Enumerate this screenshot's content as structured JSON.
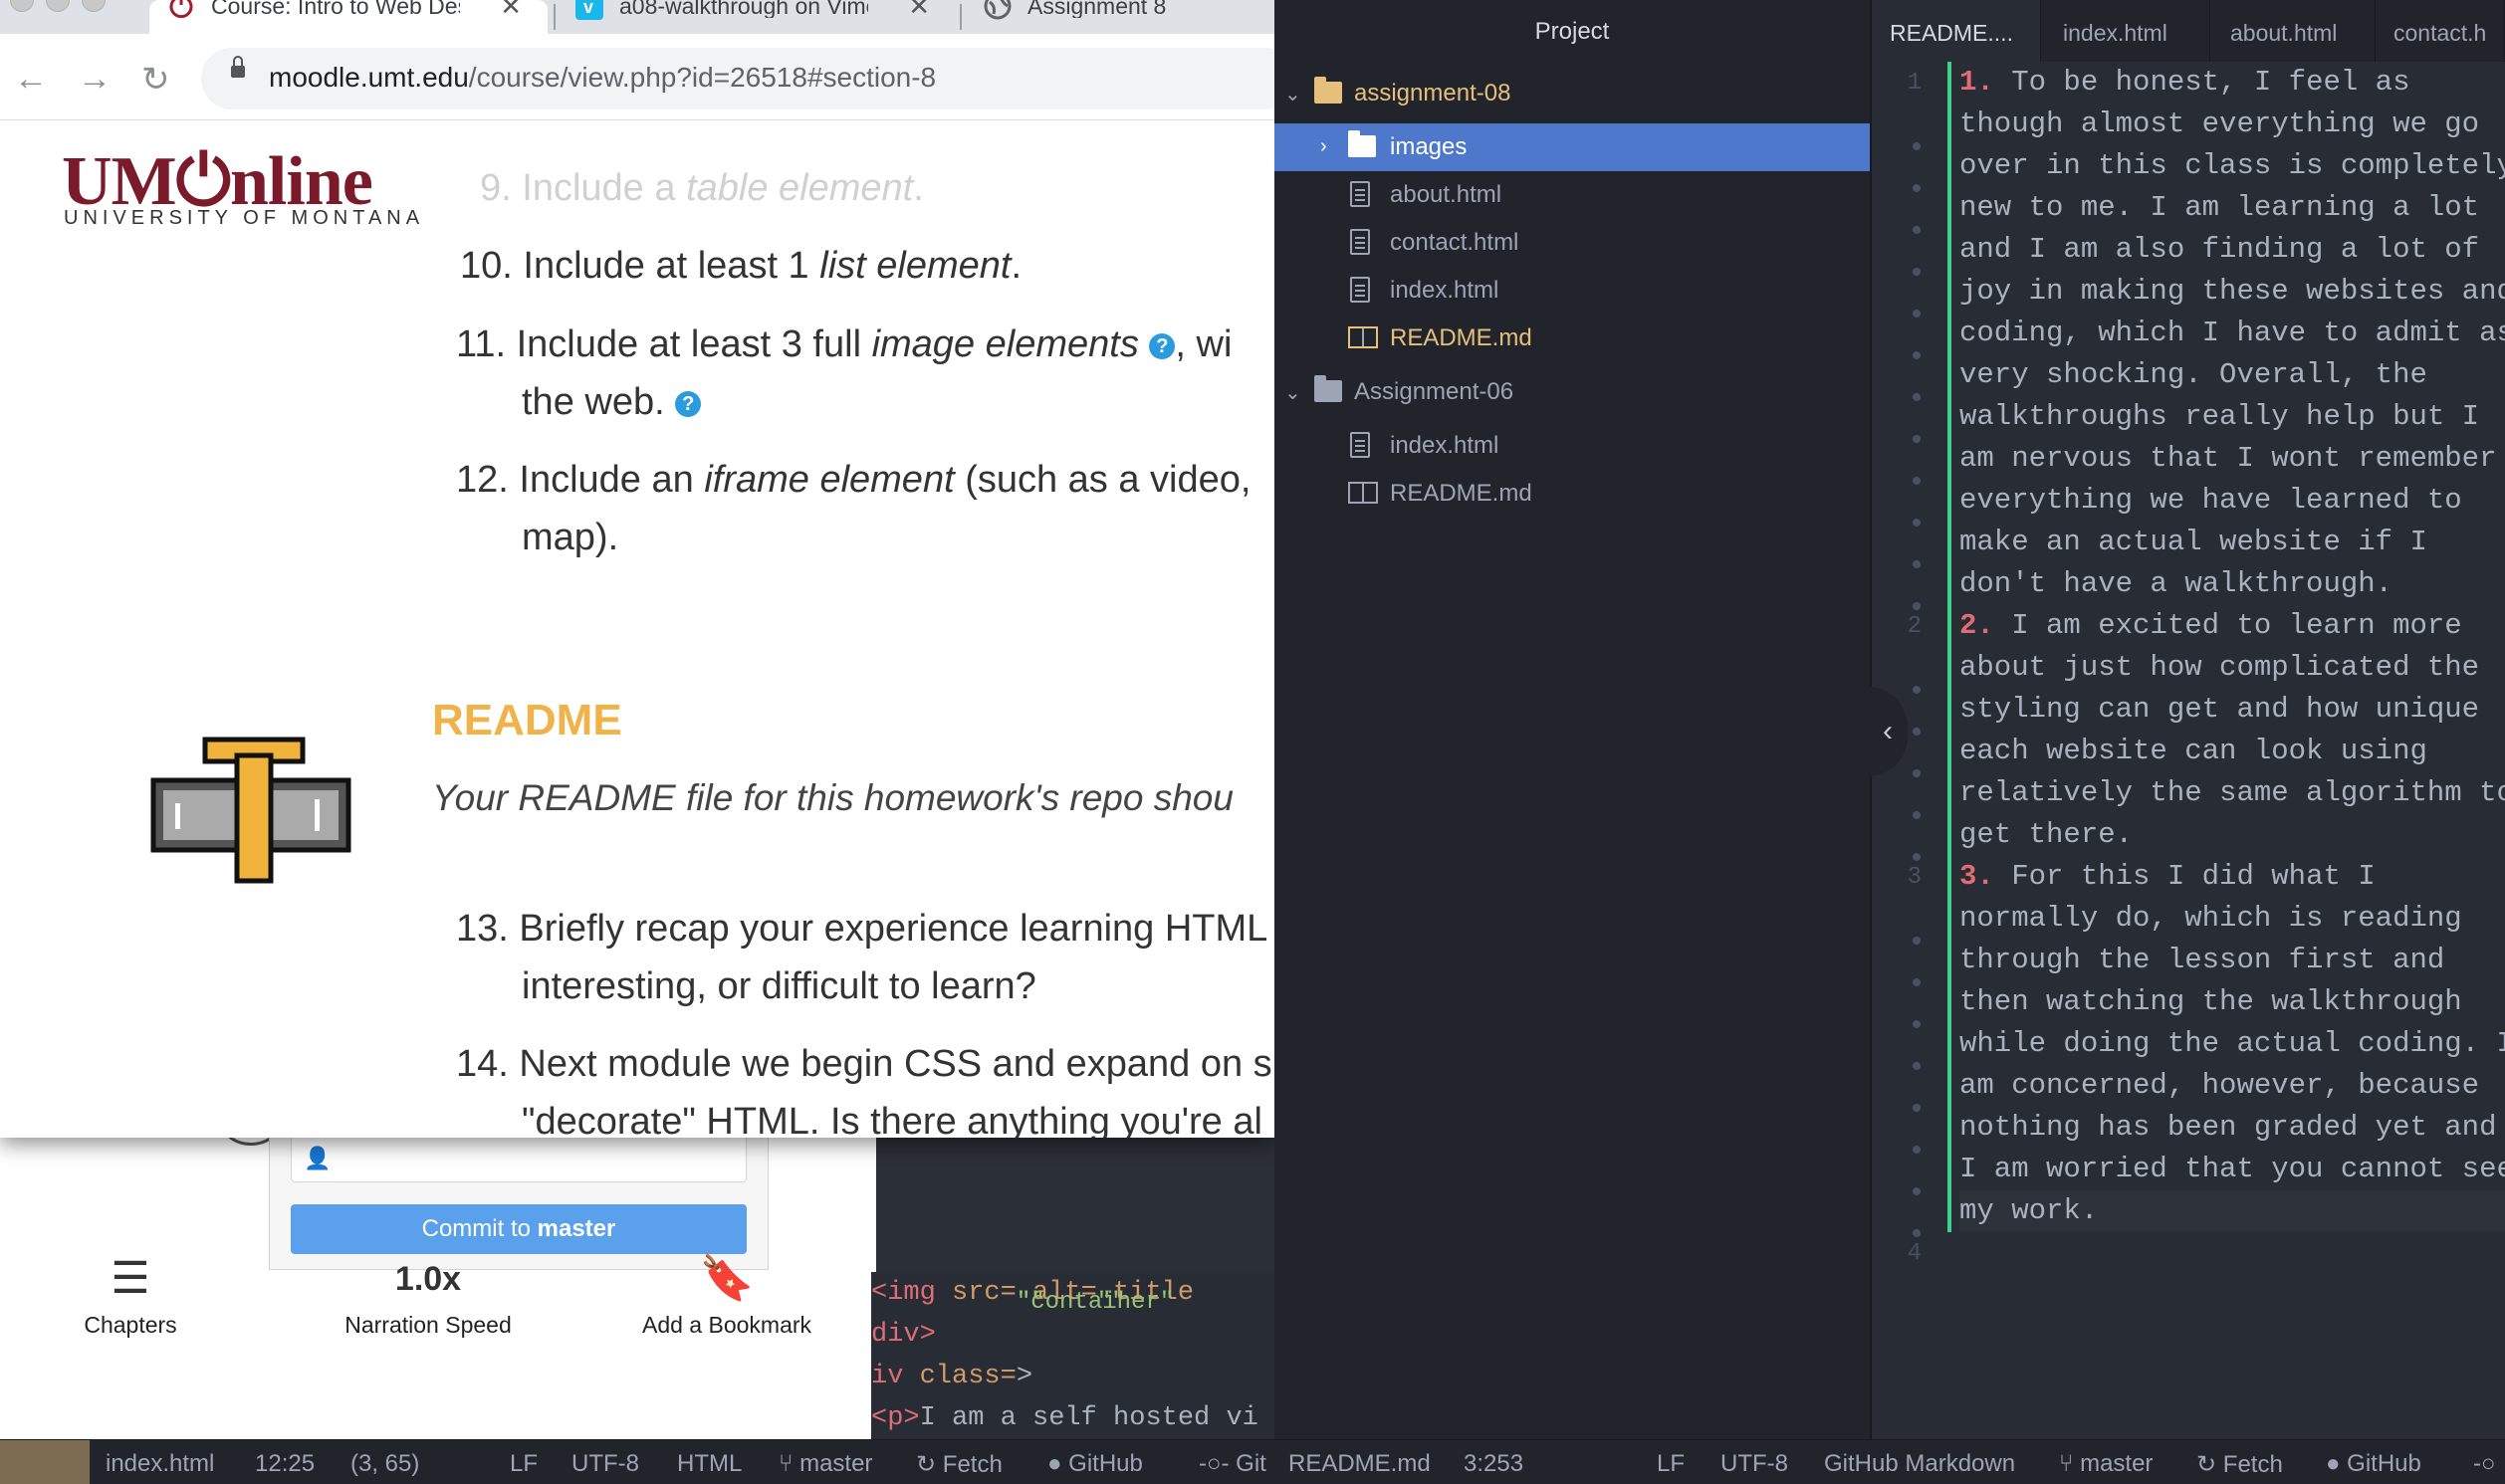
{
  "browser": {
    "tabs": [
      {
        "title": "Course: Intro to Web Desi",
        "favicon": "power-icon"
      },
      {
        "title": "a08-walkthrough on Vimeo",
        "favicon": "vimeo-icon"
      },
      {
        "title": "Assignment 8",
        "favicon": "globe-icon"
      }
    ],
    "close_glyph": "✕",
    "url_host": "moodle.umt.edu",
    "url_path": "/course/view.php?id=26518#section-8"
  },
  "page": {
    "logo_main": "UM⏻nline",
    "logo_sub": "UNIVERSITY OF MONTANA",
    "items": {
      "i9_num": "9.",
      "i9_pre": "Include a ",
      "i9_em": "table element",
      "i9_post": ".",
      "i10_num": "10.",
      "i10_pre": "Include at least 1 ",
      "i10_em": "list element",
      "i10_post": ".",
      "i11_num": "11.",
      "i11_pre": "Include at least 3 full ",
      "i11_em": "image elements",
      "i11_tail": ", wi",
      "i11_line2": "the web.",
      "i12_num": "12.",
      "i12_pre": "Include an ",
      "i12_em": "iframe element",
      "i12_post": " (such as a video,",
      "i12_line2": "map).",
      "i13_num": "13.",
      "i13_text": "Briefly recap your experience learning HTML",
      "i13_line2": "interesting, or difficult to learn?",
      "i14_num": "14.",
      "i14_text": "Next module we begin CSS and expand on s",
      "i14_line2": "\"decorate\" HTML. Is there anything you're al"
    },
    "readme_heading": "README",
    "readme_desc": "Your README file for this homework's repo shou",
    "help_glyph": "?"
  },
  "video": {
    "chapters": "Chapters",
    "speed_value": "1.0x",
    "speed_label": "Narration Speed",
    "bookmark": "Add a Bookmark"
  },
  "commit": {
    "button_pre": "Commit to ",
    "button_branch": "master"
  },
  "code_snippet": {
    "l1_tag": "<img",
    "l1_a1": " src=",
    "l1_v1": "\"\"",
    "l1_a2": " alt=",
    "l1_v2": "\"\"",
    "l1_a3": " title",
    "l2": "div>",
    "l3_tag": "iv",
    "l3_attr": " class=",
    "l3_val": "\"container\"",
    "l3_end": ">",
    "l4_tag": "<p>",
    "l4_text": "I am a self hosted vi"
  },
  "atom": {
    "project_title": "Project",
    "tree": {
      "folder1": "assignment-08",
      "images": "images",
      "f_about": "about.html",
      "f_contact": "contact.html",
      "f_index": "index.html",
      "f_readme": "README.md",
      "folder2": "Assignment-06",
      "f2_index": "index.html",
      "f2_readme": "README.md"
    },
    "editor_tabs": [
      "README....",
      "index.html",
      "about.html",
      "contact.h"
    ],
    "line_numbers": [
      "1",
      "2",
      "3",
      "4"
    ],
    "lines": {
      "n1": "1.",
      "l1_0": " To be honest, I feel as",
      "l1_1": "though almost everything we go",
      "l1_2": "over in this class is completely",
      "l1_3": "new to me. I am learning a lot",
      "l1_4": "and I am also finding a lot of",
      "l1_5": "joy in making these websites and",
      "l1_6": "coding, which I have to admit as",
      "l1_7": "very shocking. Overall, the",
      "l1_8": "walkthroughs really help but I",
      "l1_9": "am nervous that I wont remember",
      "l1_10": "everything we have learned to",
      "l1_11": "make an actual website if I",
      "l1_12": "don't have a walkthrough.",
      "n2": "2.",
      "l2_0": " I am excited to learn more",
      "l2_1": "about just how complicated the",
      "l2_2": "styling can get and how unique",
      "l2_3": "each website can look using",
      "l2_4": "relatively the same algorithm to",
      "l2_5": "get there.",
      "n3": "3.",
      "l3_0": " For this I did what I",
      "l3_1": "normally do, which is reading",
      "l3_2": "through the lesson first and",
      "l3_3": "then watching the walkthrough",
      "l3_4": "while doing the actual coding. I",
      "l3_5": "am concerned, however, because",
      "l3_6": "nothing has been graded yet and",
      "l3_7": "I am worried that you cannot see",
      "l3_8": "my work."
    }
  },
  "status_left": {
    "file": "index.html",
    "time": "12:25",
    "pos": "(3, 65)",
    "eol": "LF",
    "enc": "UTF-8",
    "grammar": "HTML",
    "branch": "master",
    "fetch": "Fetch",
    "github": "GitHub",
    "git": "Git"
  },
  "status_right": {
    "file": "README.md",
    "pos": "3:253",
    "eol": "LF",
    "enc": "UTF-8",
    "grammar": "GitHub Markdown",
    "branch": "master",
    "fetch": "Fetch",
    "github": "GitHub"
  },
  "colors": {
    "atom_bg": "#282c34",
    "tree_bg": "#21252b",
    "selection": "#4d78cc",
    "git_added": "#43d08a",
    "um_maroon": "#7a1a2b",
    "readme_heading": "#f0b34a",
    "commit_button": "#5aa0ea",
    "list_number": "#e06c75"
  }
}
